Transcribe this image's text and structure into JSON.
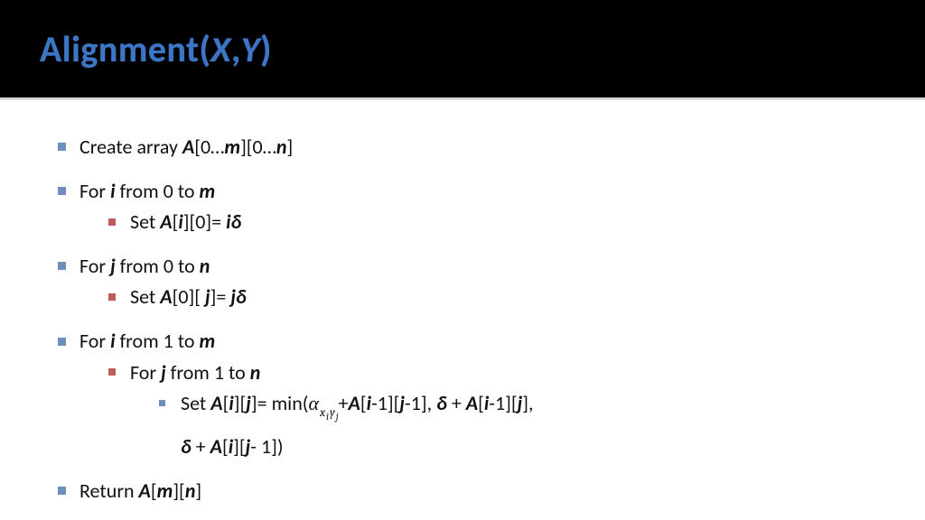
{
  "title": {
    "fn": "Alignment",
    "lp": "(",
    "x": "X",
    "comma": ",",
    "y": "Y",
    "rp": ")"
  },
  "algo": {
    "l1": {
      "t1": "Create array ",
      "A": "A",
      "t2": "[0…",
      "m": "m",
      "t3": "][0…",
      "n": "n",
      "t4": "]"
    },
    "l2": {
      "t1": "For ",
      "i": "i",
      "t2": " from 0 to ",
      "m": "m"
    },
    "l3": {
      "t1": "Set ",
      "A": "A",
      "lb1": "[",
      "i": "i",
      "rb1": "][0]= ",
      "i2": "i",
      "d": "δ"
    },
    "l4": {
      "t1": "For ",
      "j": "j",
      "t2": " from 0 to ",
      "n": "n"
    },
    "l5": {
      "t1": "Set ",
      "A": "A",
      "lb1": "[0][ ",
      "j": "j",
      "rb1": "]= ",
      "j2": "j",
      "d": "δ"
    },
    "l6": {
      "t1": "For ",
      "i": "i",
      "t2": " from 1 to ",
      "m": "m"
    },
    "l7": {
      "t1": "For ",
      "j": "j",
      "t2": " from 1 to ",
      "n": "n"
    },
    "l8": {
      "t1": "Set ",
      "A": "A",
      "lb1": "[",
      "i": "i",
      "mid1": "][",
      "j": "j",
      "rb1": "]= min(",
      "alpha": "α",
      "sx": "x",
      "si": "i",
      "sy": "y",
      "sj": "j",
      "plus1": "+",
      "A2": "A",
      "lb2": "[",
      "i2": "i",
      "m1": "-1][",
      "j2": "j",
      "rb2": "-1], ",
      "d1": "δ",
      "plus2": " + ",
      "A3": "A",
      "lb3": "[",
      "i3": "i",
      "m2": "-1][",
      "j3": "j",
      "rb3": "],",
      "d2": "δ",
      "plus3": " + ",
      "A4": "A",
      "lb4": "[",
      "i4": "i",
      "mid4": "][",
      "j4": "j",
      "rb4": "- 1])"
    },
    "l9": {
      "t1": "Return ",
      "A": "A",
      "lb1": "[",
      "m": "m",
      "mid": "][",
      "n": "n",
      "rb1": "]"
    }
  }
}
